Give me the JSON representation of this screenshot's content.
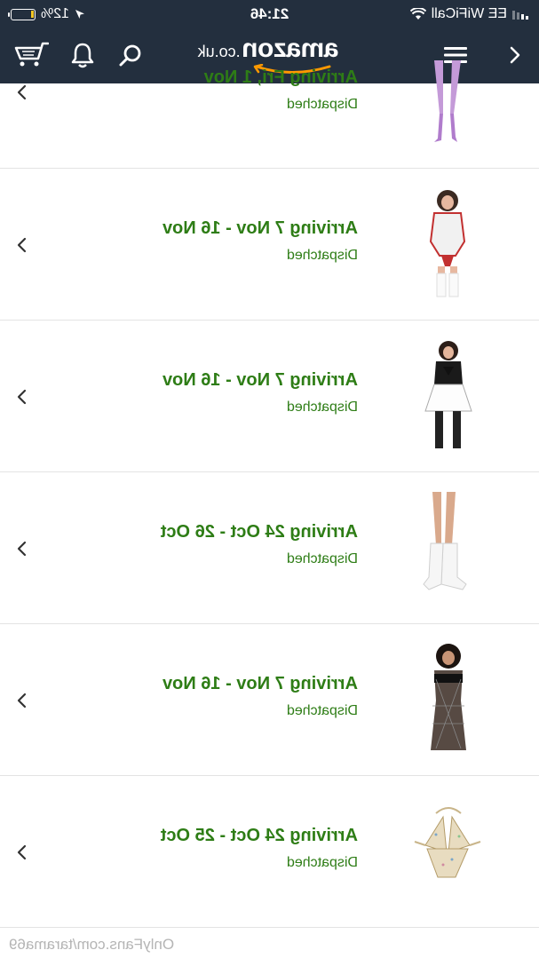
{
  "status_bar": {
    "carrier": "EE WiFiCall",
    "time": "21:46",
    "battery_percent": "12%",
    "battery_level": 0.12
  },
  "header": {
    "logo_text": "amazon",
    "logo_tld": ".co.uk",
    "icons": [
      "back-chevron-icon",
      "menu-icon",
      "search-icon",
      "bell-icon",
      "cart-icon"
    ]
  },
  "orders": [
    {
      "arrival": "Arriving Fri, 1 Nov",
      "status": "Dispatched",
      "product_icon": "stockings-product-image"
    },
    {
      "arrival": "Arriving 7 Nov - 16 Nov",
      "status": "Dispatched",
      "product_icon": "nurse-costume-product-image"
    },
    {
      "arrival": "Arriving 7 Nov - 16 Nov",
      "status": "Dispatched",
      "product_icon": "maid-costume-product-image"
    },
    {
      "arrival": "Arriving 24 Oct - 26 Oct",
      "status": "Dispatched",
      "product_icon": "leg-warmers-product-image"
    },
    {
      "arrival": "Arriving 7 Nov - 16 Nov",
      "status": "Dispatched",
      "product_icon": "fishnet-dress-product-image"
    },
    {
      "arrival": "Arriving 24 Oct - 25 Oct",
      "status": "Dispatched",
      "product_icon": "sequin-bikini-product-image"
    }
  ],
  "watermark": "OnlyFans.com/tarama69",
  "colors": {
    "header_bg": "#232f3e",
    "arrival_green": "#2e7d16",
    "logo_smile": "#ff9900"
  }
}
